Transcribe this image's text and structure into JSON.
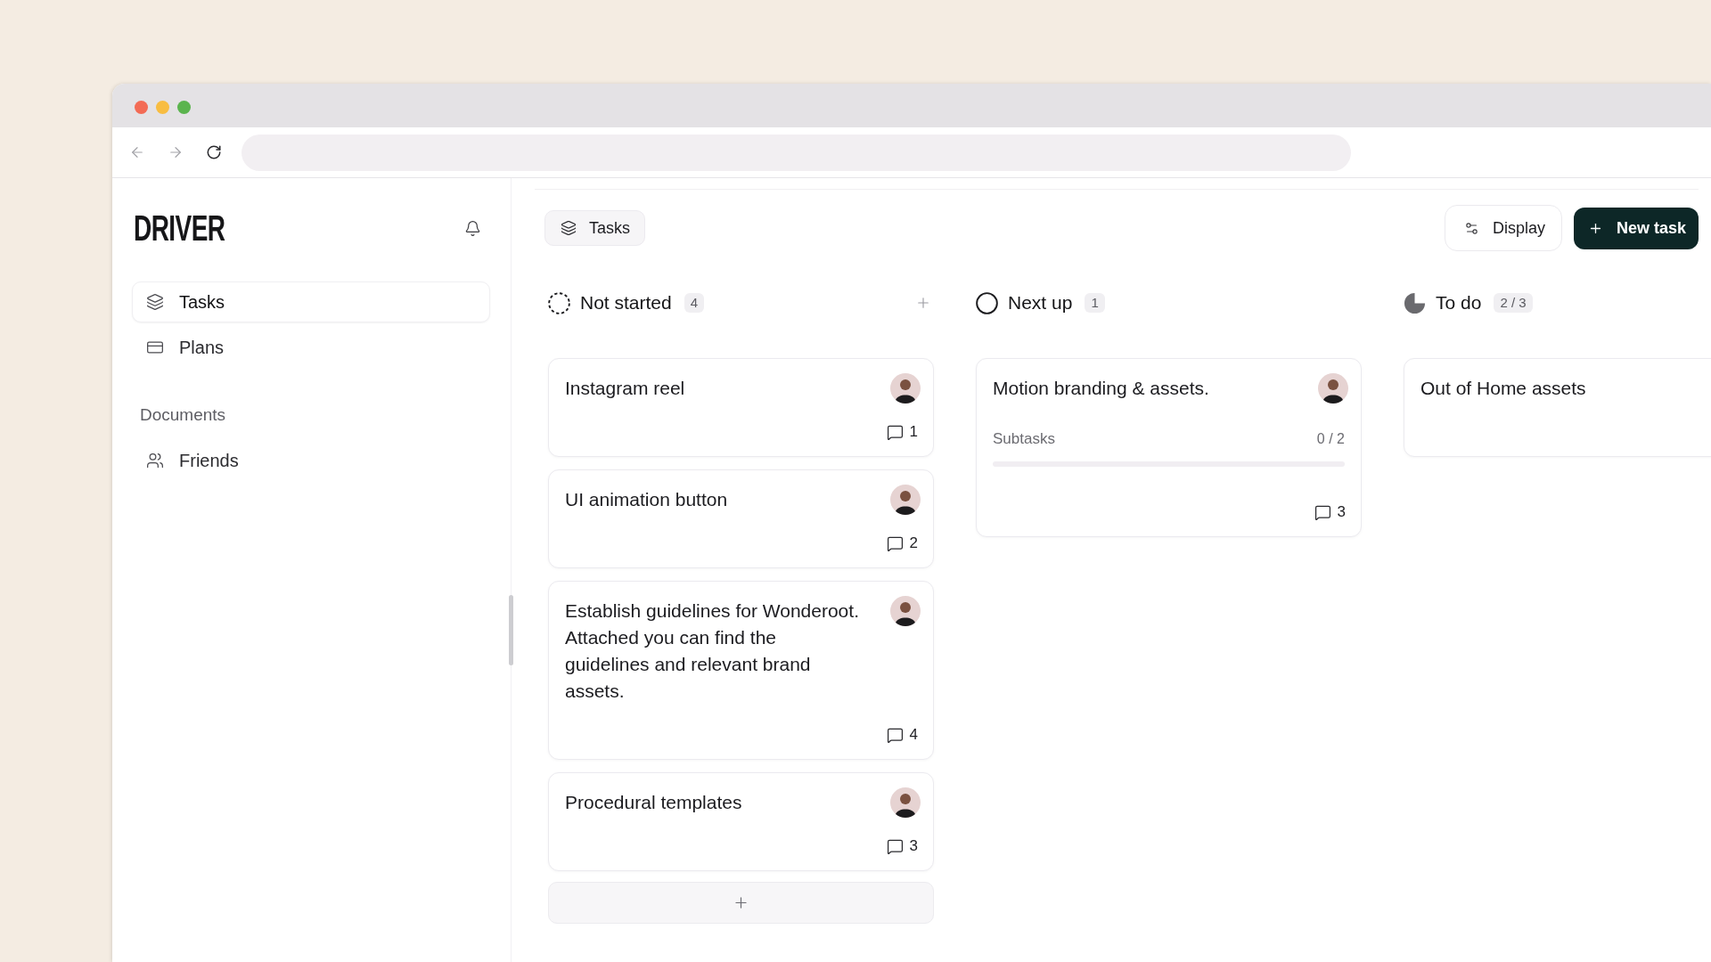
{
  "browser": {
    "back": {
      "disabled": true
    },
    "forward": {
      "disabled": true
    }
  },
  "sidebar": {
    "logo": "DRIVER",
    "nav": [
      {
        "label": "Tasks",
        "selected": true
      },
      {
        "label": "Plans",
        "selected": false
      }
    ],
    "sections": [
      {
        "title": "Documents",
        "items": [
          {
            "label": "Friends",
            "selected": false
          }
        ]
      }
    ]
  },
  "header": {
    "view": {
      "label": "Tasks"
    },
    "buttons": [
      {
        "label": "Display",
        "kind": "secondary"
      },
      {
        "label": "New task",
        "kind": "primary"
      }
    ]
  },
  "board": {
    "columns": [
      {
        "kind": "backlog",
        "title": "Not started",
        "count": "4",
        "add_in_header": true,
        "add_card": true,
        "cards": [
          {
            "title": "Instagram reel",
            "avatar": true,
            "comments": "1"
          },
          {
            "title": "UI animation button",
            "avatar": true,
            "comments": "2"
          },
          {
            "title": "Establish guidelines for Wonderoot. Attached you can find the guidelines and relevant brand assets.",
            "avatar": true,
            "comments": "4"
          },
          {
            "title": "Procedural templates",
            "avatar": true,
            "comments": "3"
          }
        ]
      },
      {
        "kind": "unstarted",
        "title": "Next up",
        "count": "1",
        "add_in_header": false,
        "add_card": false,
        "cards": [
          {
            "title": "Motion branding & assets.",
            "avatar": true,
            "subtasks": {
              "label": "Subtasks",
              "count": "0 / 2"
            },
            "comments": "3"
          }
        ]
      },
      {
        "kind": "started",
        "title": "To do",
        "count": "2 / 3",
        "cards": [
          {
            "title": "Out of Home assets"
          }
        ]
      }
    ]
  }
}
